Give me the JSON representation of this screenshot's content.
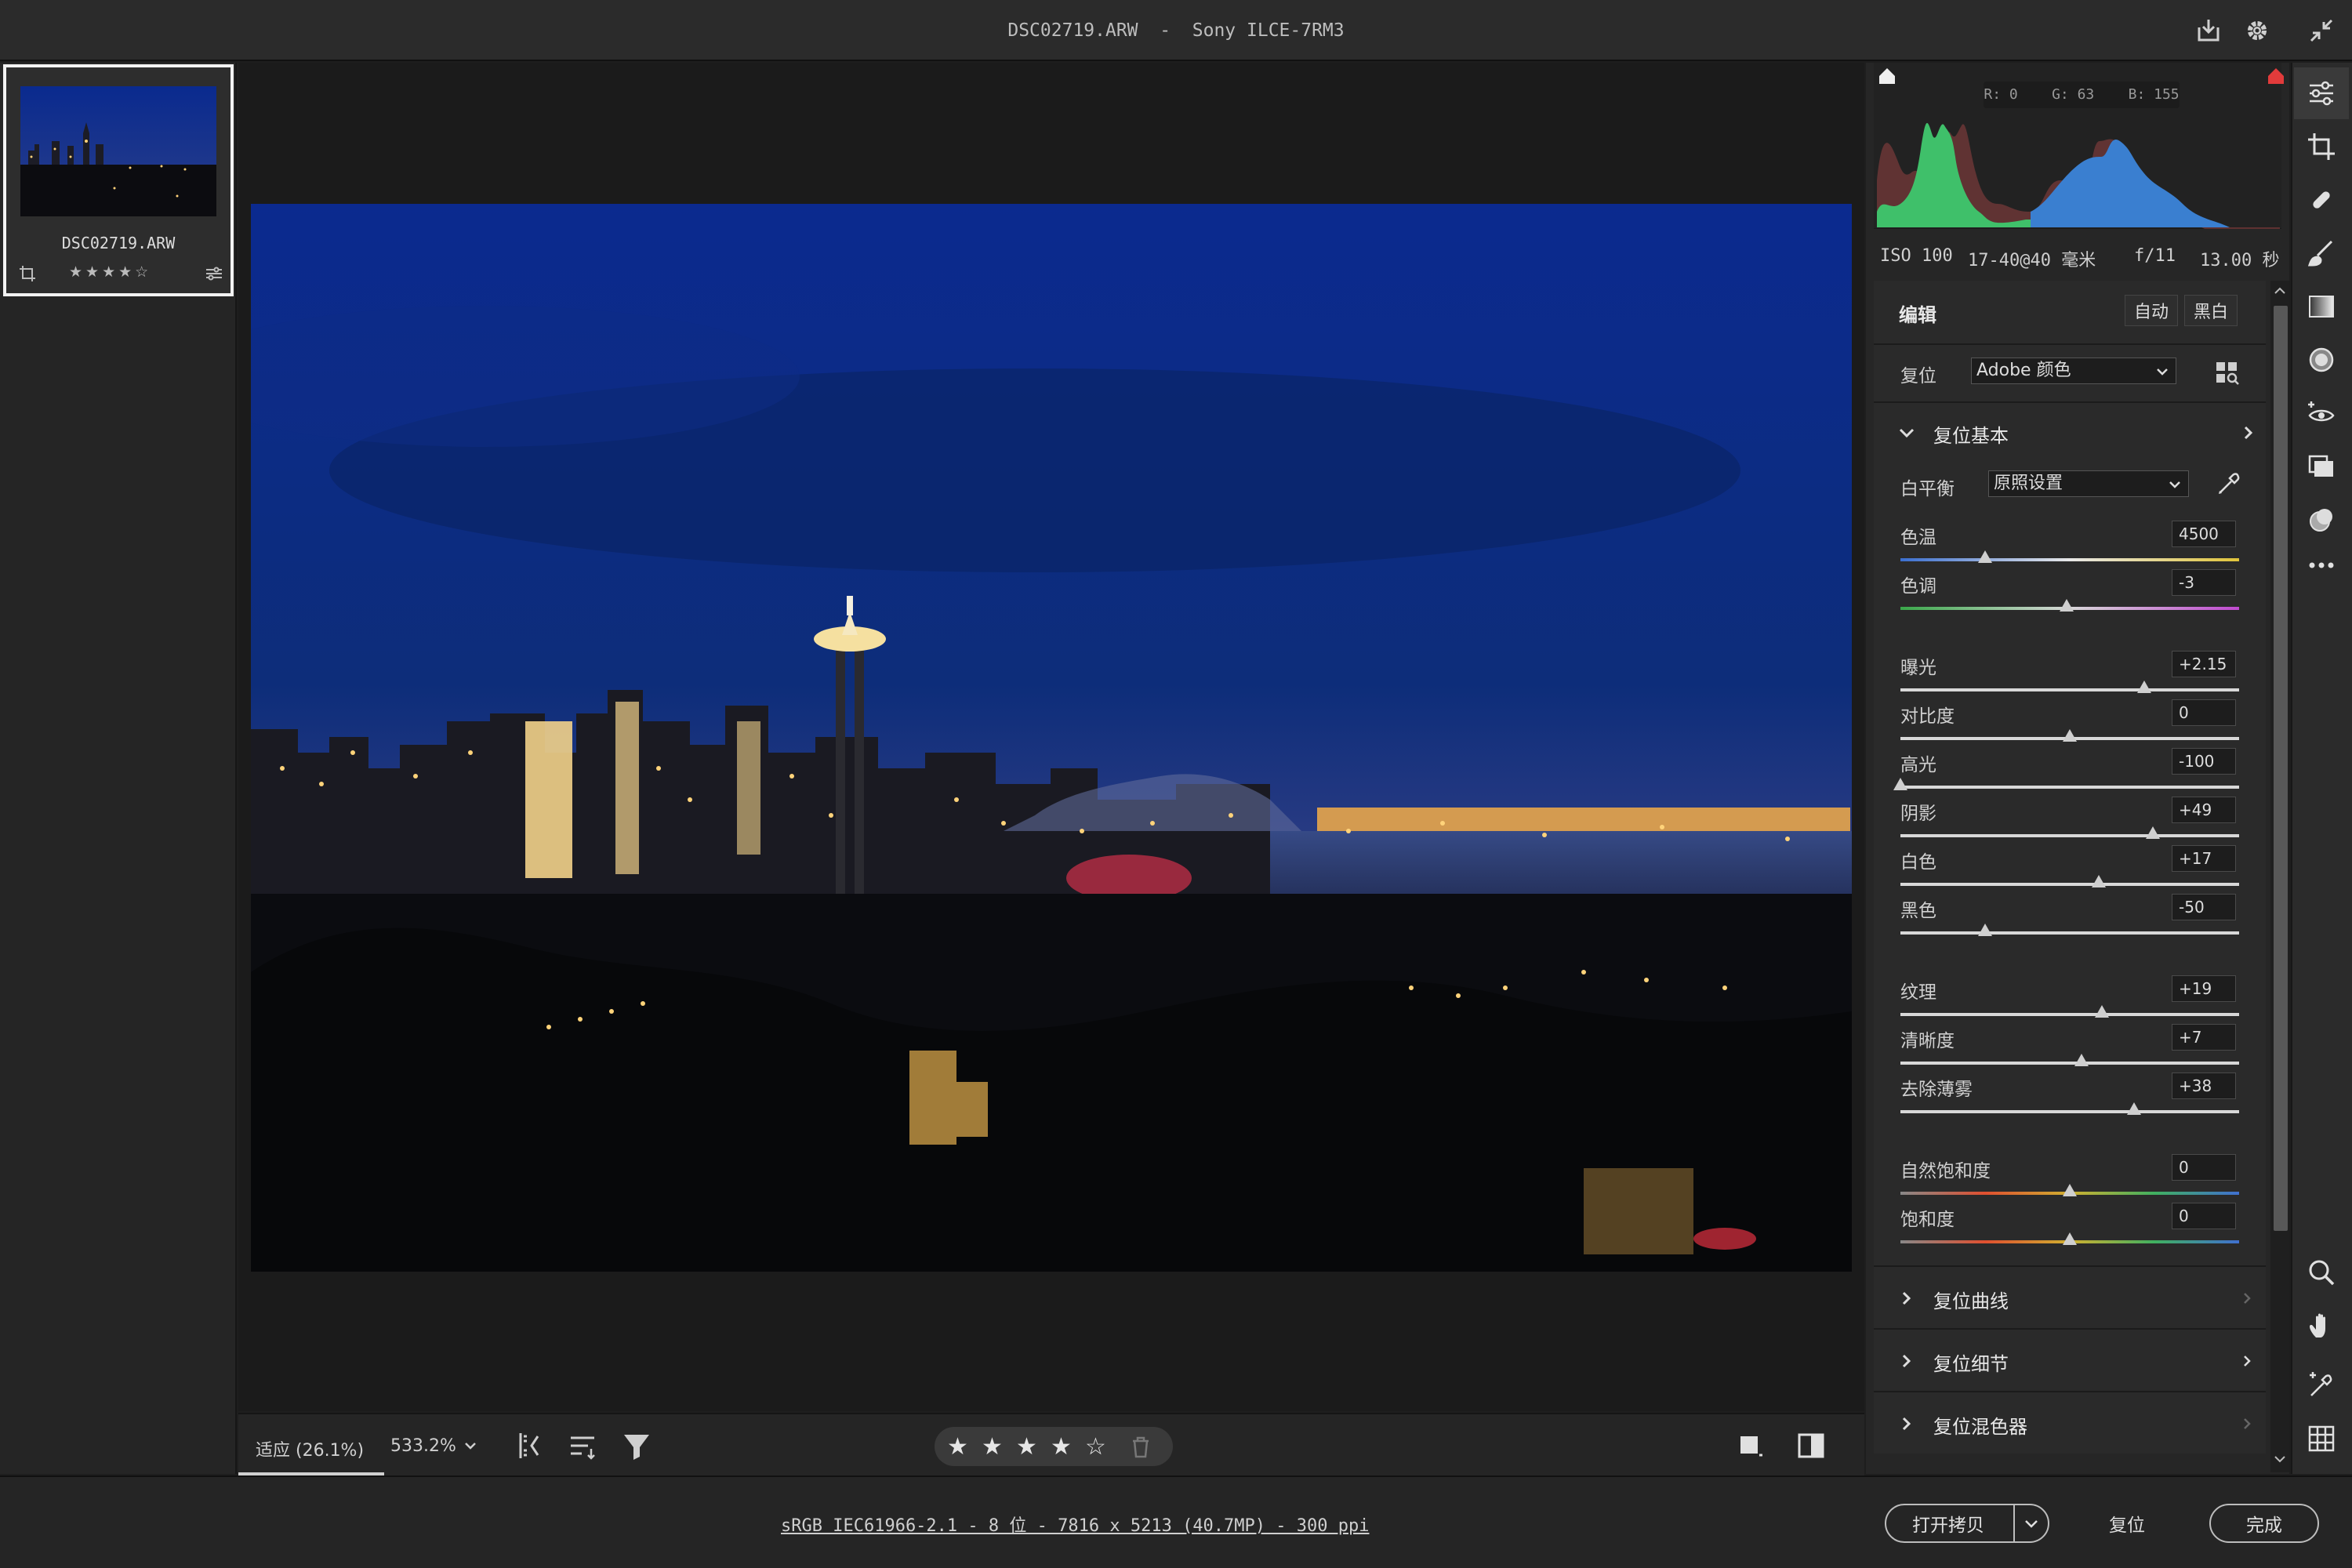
{
  "window": {
    "title": "DSC02719.ARW  -  Sony ILCE-7RM3"
  },
  "filmstrip": {
    "items": [
      {
        "name": "DSC02719.ARW",
        "rating": "★★★★☆"
      }
    ]
  },
  "viewbar": {
    "zoom_fit": "适应 (26.1%)",
    "zoom_value": "533.2%",
    "rating_stars": [
      "★",
      "★",
      "★",
      "★",
      "☆"
    ]
  },
  "histogram": {
    "readout": "R: 0    G: 63    B: 155"
  },
  "exif": {
    "iso": "ISO 100",
    "lens": "17-40@40 毫米",
    "aperture": "f/11",
    "shutter": "13.00 秒"
  },
  "panel": {
    "edit_title": "编辑",
    "auto_label": "自动",
    "bw_label": "黑白",
    "reset_label": "复位",
    "profile_value": "Adobe 颜色",
    "basic_title": "复位基本",
    "wb_label": "白平衡",
    "wb_value": "原照设置",
    "sliders": [
      {
        "label": "色温",
        "value": "4500",
        "pos": 0.25
      },
      {
        "label": "色调",
        "value": "-3",
        "pos": 0.49
      },
      {
        "label": "曝光",
        "value": "+2.15",
        "pos": 0.72
      },
      {
        "label": "对比度",
        "value": "0",
        "pos": 0.5
      },
      {
        "label": "高光",
        "value": "-100",
        "pos": 0.0
      },
      {
        "label": "阴影",
        "value": "+49",
        "pos": 0.745
      },
      {
        "label": "白色",
        "value": "+17",
        "pos": 0.585
      },
      {
        "label": "黑色",
        "value": "-50",
        "pos": 0.25
      },
      {
        "label": "纹理",
        "value": "+19",
        "pos": 0.595
      },
      {
        "label": "清晰度",
        "value": "+7",
        "pos": 0.535
      },
      {
        "label": "去除薄雾",
        "value": "+38",
        "pos": 0.69
      },
      {
        "label": "自然饱和度",
        "value": "0",
        "pos": 0.5
      },
      {
        "label": "饱和度",
        "value": "0",
        "pos": 0.5
      }
    ],
    "collapsed_sections": [
      "复位曲线",
      "复位细节",
      "复位混色器"
    ]
  },
  "bottombar": {
    "file_info": "sRGB IEC61966-2.1 - 8 位 - 7816 x 5213 (40.7MP) - 300 ppi",
    "open_copy": "打开拷贝",
    "reset": "复位",
    "done": "完成"
  },
  "colors": {
    "accent_red": "#e23b3b",
    "background": "#1e1e1e"
  }
}
